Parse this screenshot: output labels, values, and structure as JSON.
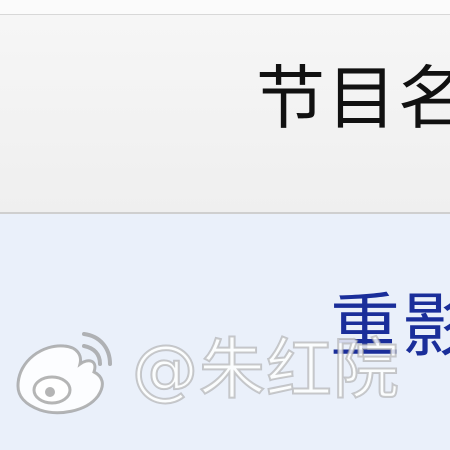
{
  "table": {
    "header_label": "节目名",
    "row_link_label": "重影"
  },
  "watermark": {
    "icon": "weibo-icon",
    "text": "@朱红院"
  },
  "colors": {
    "header_bg": "#f3f3f3",
    "row_bg": "#eaf0fa",
    "link": "#1a2e9a"
  }
}
